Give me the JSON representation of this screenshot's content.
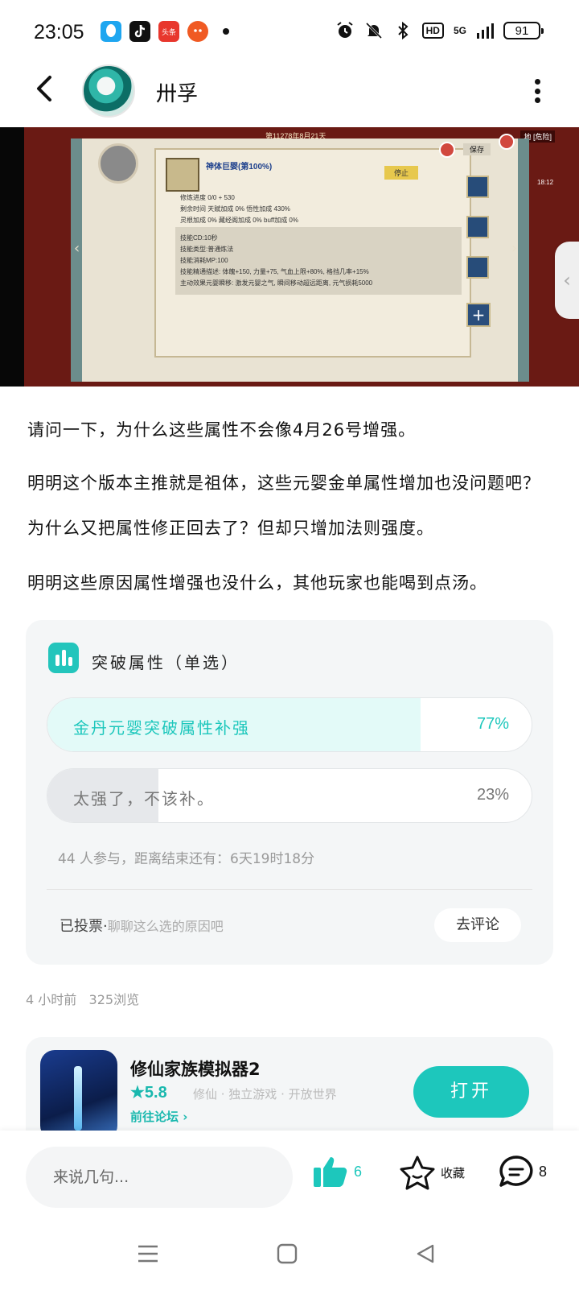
{
  "status_bar": {
    "time": "23:05",
    "apps": [
      {
        "icon": "qq-icon",
        "color": "#1ea6f0"
      },
      {
        "icon": "douyin-icon",
        "color": "#111111"
      },
      {
        "icon": "toutiao-icon",
        "color": "#e8372d",
        "label": "头条"
      },
      {
        "icon": "game-app-icon",
        "color": "#f05a23"
      }
    ],
    "network": "5G",
    "hd": "HD",
    "battery": "91"
  },
  "header": {
    "author_name": "卅孚"
  },
  "screenshot": {
    "date_text": "第11278年8月21天",
    "corner_text": "地 [危险]",
    "skill_name": "神体巨婴(第100%)",
    "stop_label": "停止",
    "save_label": "保存",
    "time_text": "18:12",
    "lines": [
      "修炼进度 0/0                    + 530",
      "剩余时间   天赋加成 0%        悟性加成 430%",
      "           灵根加成 0%    藏经阁加成 0%   buff加成 0%",
      "技能CD:10秒",
      "技能类型:普通炼法",
      "技能消耗MP:100",
      "技能精通描述: 体魄+150, 力量+75, 气血上限+80%, 格挡几率+15%",
      "主动效果元婴瞬移: 激发元婴之气, 瞬间移动超远距离, 元气损耗5000"
    ]
  },
  "post": {
    "paragraphs": [
      "请问一下，为什么这些属性不会像4月26号增强。",
      "明明这个版本主推就是祖体，这些元婴金单属性增加也没问题吧？为什么又把属性修正回去了？但却只增加法则强度。",
      "明明这些原因属性增强也没什么，其他玩家也能喝到点汤。"
    ],
    "time_ago": "4 小时前",
    "views": "325浏览"
  },
  "poll": {
    "title": "突破属性",
    "type": "（单选）",
    "options": [
      {
        "label": "金丹元婴突破属性补强",
        "percent": 77,
        "percent_text": "77%",
        "selected": true
      },
      {
        "label": "太强了，不该补。",
        "percent": 23,
        "percent_text": "23%",
        "selected": false
      }
    ],
    "meta": "44 人参与，距离结束还有：6天19时18分",
    "voted_label": "已投票",
    "voted_hint": "聊聊这么选的原因吧",
    "comment_button": "去评论",
    "colors": {
      "accent": "#1dc7bc",
      "selected_fill": "#e3faf8",
      "unselected_fill": "#e6e8eb"
    }
  },
  "game_card": {
    "name": "修仙家族模拟器2",
    "score": "★5.8",
    "tags": "修仙 · 独立游戏 · 开放世界",
    "forum": "前往论坛",
    "open_button": "打开"
  },
  "bottom_bar": {
    "comment_placeholder": "来说几句...",
    "likes": "6",
    "favorite_label": "收藏",
    "comments": "8"
  }
}
